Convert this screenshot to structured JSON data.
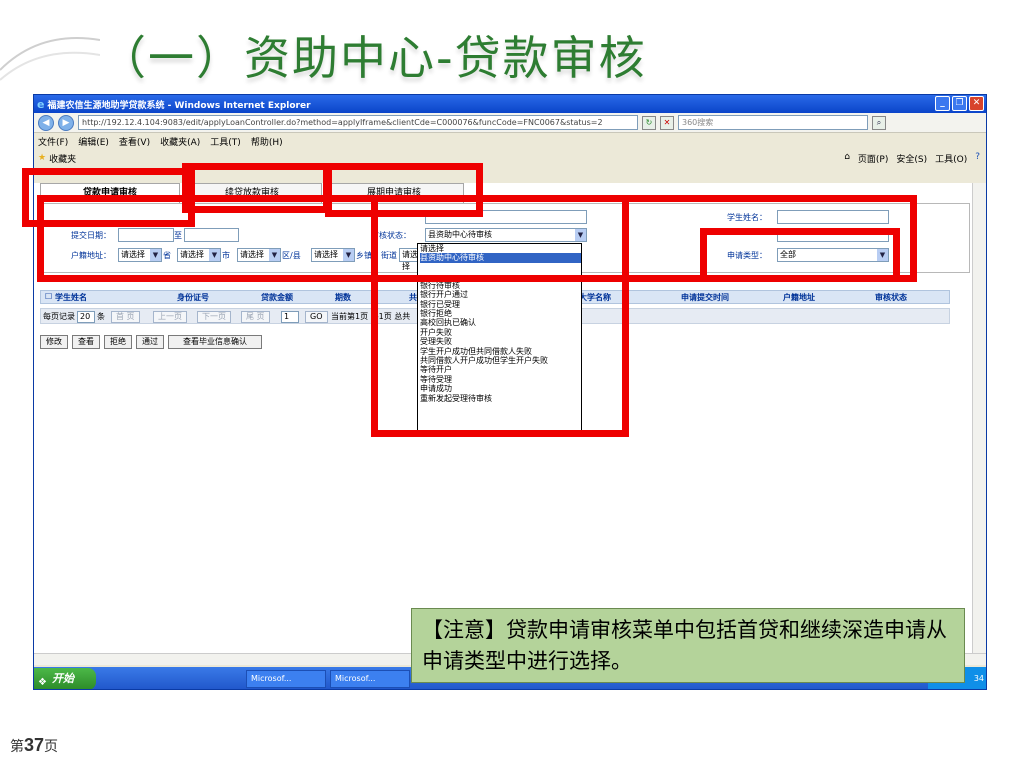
{
  "slide": {
    "title": "（一）资助中心-贷款审核",
    "page_prefix": "第",
    "page_number": "37",
    "page_suffix": "页"
  },
  "browser": {
    "window_title": "福建农信生源地助学贷款系统 - Windows Internet Explorer",
    "url": "http://192.12.4.104:9083/edit/applyLoanController.do?method=applyIframe&clientCde=C000076&funcCode=FNC0067&status=2",
    "search_placeholder": "360搜索",
    "menu": [
      "文件(F)",
      "编辑(E)",
      "查看(V)",
      "收藏夹(A)",
      "工具(T)",
      "帮助(H)"
    ],
    "favbar_label": "收藏夹",
    "toolbar_right": [
      "页面(P)",
      "安全(S)",
      "工具(O)"
    ]
  },
  "tabs": [
    "贷款申请审核",
    "续贷放款审核",
    "展期申请审核"
  ],
  "form": {
    "submit_date_label": "提交日期：",
    "to_label": "至",
    "address_label": "户籍地址：",
    "select_placeholder": "请选择",
    "province": "省",
    "city": "市",
    "district": "区/县",
    "township": "乡镇",
    "street": "街道",
    "review_status_label": "审核状态：",
    "review_status_value": "县资助中心待审核",
    "student_name_label": "学生姓名：",
    "apply_type_label": "申请类型：",
    "apply_type_value": "全部"
  },
  "dropdown_options": [
    "请选择",
    "县资助中心待审核",
    "银行待审核",
    "银行开户通过",
    "银行已受理",
    "银行拒绝",
    "高校回执已确认",
    "开户失败",
    "受理失败",
    "学生开户成功但共同借款人失败",
    "共同借款人开户成功但学生开户失败",
    "等待开户",
    "等待受理",
    "申请成功",
    "重新发起受理待审核"
  ],
  "grid_headers": [
    "学生姓名",
    "身份证号",
    "贷款金额",
    "期数",
    "共",
    "大学名称",
    "申请提交时间",
    "户籍地址",
    "审核状态"
  ],
  "pager": {
    "per_page_label": "每页记录",
    "per_page_value": "20",
    "per_page_unit": "条",
    "first": "首 页",
    "prev": "上一页",
    "next": "下一页",
    "last": "尾 页",
    "page_value": "1",
    "go": "GO",
    "current_info": "当前第1页 共1页 总共"
  },
  "actions": [
    "修改",
    "查看",
    "拒绝",
    "通过",
    "查看毕业信息确认"
  ],
  "taskbar": {
    "start": "开始",
    "items": [
      "Microsof...",
      "Microsof..."
    ],
    "clock": "34"
  },
  "note": "【注意】贷款申请审核菜单中包括首贷和继续深造申请从申请类型中进行选择。",
  "colors": {
    "title": "#2e7d32",
    "highlight": "#ee0000",
    "note_bg": "#b4d39a",
    "titlebar": "#0a44c9"
  }
}
